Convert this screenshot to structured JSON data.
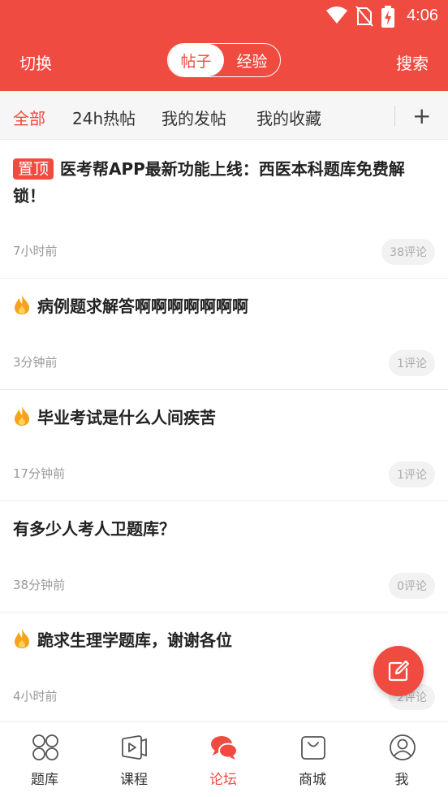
{
  "status": {
    "time": "4:06",
    "wifi_icon": "wifi-icon",
    "sim_icon": "no-sim-icon",
    "battery_icon": "battery-charging-icon"
  },
  "header": {
    "left": "切换",
    "right": "搜索",
    "segments": [
      {
        "label": "帖子",
        "active": true
      },
      {
        "label": "经验",
        "active": false
      }
    ]
  },
  "tabs": {
    "items": [
      {
        "label": "全部",
        "active": true
      },
      {
        "label": "24h热帖",
        "active": false
      },
      {
        "label": "我的发帖",
        "active": false
      },
      {
        "label": "我的收藏",
        "active": false
      }
    ],
    "add": "+"
  },
  "posts": [
    {
      "badge": "置顶",
      "title": "医考帮APP最新功能上线：西医本科题库免费解锁！",
      "time": "7小时前",
      "comments": "38评论",
      "hot": false
    },
    {
      "title": "病例题求解答啊啊啊啊啊啊啊",
      "time": "3分钟前",
      "comments": "1评论",
      "hot": true
    },
    {
      "title": "毕业考试是什么人间疾苦",
      "time": "17分钟前",
      "comments": "1评论",
      "hot": true
    },
    {
      "title": "有多少人考人卫题库？",
      "time": "38分钟前",
      "comments": "0评论",
      "hot": false
    },
    {
      "title": "跪求生理学题库，谢谢各位",
      "time": "4小时前",
      "comments": "2评论",
      "hot": true
    }
  ],
  "fab_icon": "compose-icon",
  "nav": [
    {
      "label": "题库",
      "icon": "grid-icon",
      "active": false
    },
    {
      "label": "课程",
      "icon": "video-icon",
      "active": false
    },
    {
      "label": "论坛",
      "icon": "chat-bubbles-icon",
      "active": true
    },
    {
      "label": "商城",
      "icon": "shopping-bag-icon",
      "active": false
    },
    {
      "label": "我",
      "icon": "user-icon",
      "active": false
    }
  ],
  "colors": {
    "accent": "#ef4b40",
    "muted": "#999999"
  }
}
